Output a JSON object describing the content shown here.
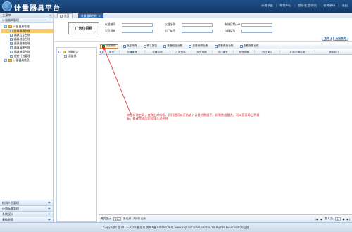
{
  "header": {
    "title": "计量器具平台",
    "nav": [
      "计量平台",
      "帮助中心",
      "登录名:管理员",
      "修改密码",
      "退出"
    ]
  },
  "sidebar": {
    "menu_label": "主菜单",
    "collapse_glyph": "«",
    "group_title": "计量器具管理",
    "tree": [
      {
        "label": "计量器具管理",
        "level": 0
      },
      {
        "label": "计量器具台账",
        "level": 1,
        "selected": true
      },
      {
        "label": "器具检定台账",
        "level": 1
      },
      {
        "label": "器具校准台账",
        "level": 1
      },
      {
        "label": "器具维修台账",
        "level": 1
      },
      {
        "label": "器具报废台账",
        "level": 1
      },
      {
        "label": "器具借用台账",
        "level": 1
      },
      {
        "label": "检定计划管理",
        "level": 1
      },
      {
        "label": "计量器具信息",
        "level": 0
      }
    ],
    "bottom": [
      "检测人员管理",
      "计量标准管理",
      "系统设计",
      "基础配置"
    ]
  },
  "tabs": [
    {
      "label": "首页",
      "active": false
    },
    {
      "label": "计量器具台账",
      "active": true
    }
  ],
  "filters": {
    "placeholder_label": "广告位招租",
    "fields": [
      {
        "label": "仪器编号"
      },
      {
        "label": "仪器名称"
      },
      {
        "label": "有效日期(***)"
      },
      {
        "label": "型号规格"
      },
      {
        "label": "出厂编号"
      },
      {
        "label": "仪器类别"
      }
    ],
    "search_btn": "查询",
    "advanced_btn": "高级查询"
  },
  "left_tree": {
    "root": "计量站点",
    "child": "测量部"
  },
  "toolbar": [
    "点击新增",
    "批量修改",
    "确认报告",
    "查看检定台账",
    "查看维修台账",
    "查看借用台账",
    "查看报废台账"
  ],
  "grid": {
    "columns": [
      "序号",
      "仪器编号",
      "仪器名称",
      "广东分类",
      "型号规格",
      "出厂编号",
      "型号规格",
      "所在单位",
      "扩展不确定度",
      "使用部门"
    ]
  },
  "annotation": {
    "text": "点击新增工具，会弹出对话框，我们就可以开始输入计量的数据了。如果数据量大，可以直接导出到模板，修改完成后即可导入进平台"
  },
  "pager": {
    "page_size": "20",
    "left_text": "每页显示",
    "left_text2": "条记录",
    "total_text": "共0条记录",
    "right_text": "第 1 页",
    "page": "1"
  },
  "footer": {
    "text": "Copyright @2013-2020 备案号 苏ICP备13048538号 www.xxjl.net FreeUser Inc All Rights Reserved 00运营"
  }
}
